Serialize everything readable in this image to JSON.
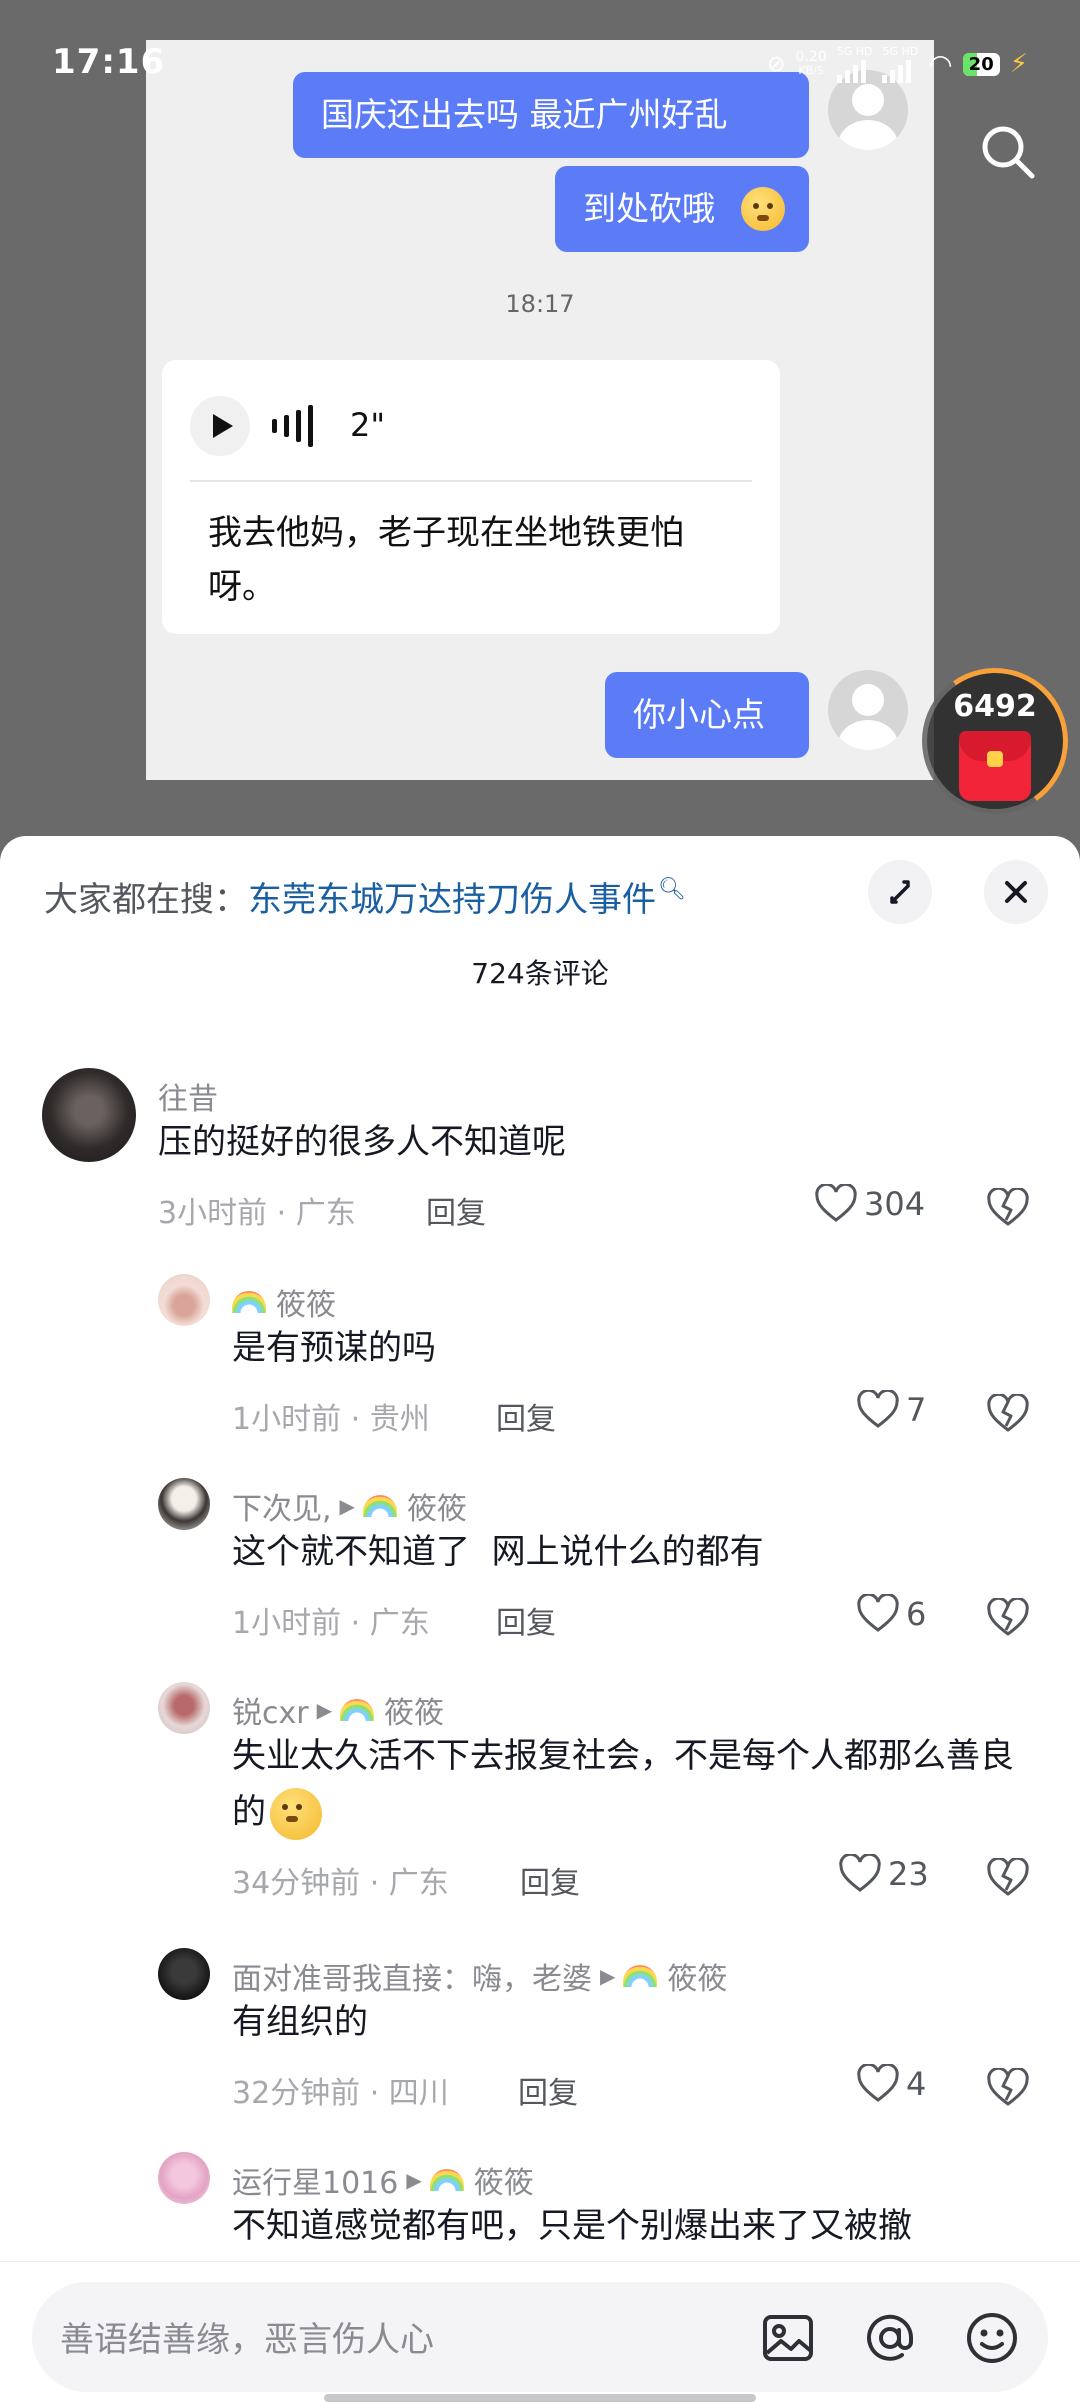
{
  "status_bar": {
    "time": "17:16",
    "net_speed": "0.20",
    "net_unit": "KB/S",
    "sim1": "5G HD",
    "sim2": "5G HD",
    "battery": "20"
  },
  "video": {
    "chat": {
      "msg1": "国庆还出去吗 最近广州好乱",
      "msg2": "到处砍哦",
      "timestamp": "18:17",
      "voice_duration": "2\"",
      "voice_transcript": "我去他妈，老子现在坐地铁更怕呀。",
      "msg3": "你小心点"
    },
    "red_packet_count": "6492"
  },
  "comment_panel": {
    "hot_prefix": "大家都在搜：",
    "hot_topic": "东莞东城万达持刀伤人事件",
    "count_label": "724条评论",
    "comments": [
      {
        "name": "往昔",
        "text": "压的挺好的很多人不知道呢",
        "meta": "3小时前 · 广东",
        "reply": "回复",
        "likes": "304"
      },
      {
        "name": "筱筱",
        "text": "是有预谋的吗",
        "meta": "1小时前 · 贵州",
        "reply": "回复",
        "likes": "7"
      },
      {
        "name": "下次见,",
        "target": "筱筱",
        "text": "这个就不知道了  网上说什么的都有",
        "meta": "1小时前 · 广东",
        "reply": "回复",
        "likes": "6"
      },
      {
        "name": "锐cxr",
        "target": "筱筱",
        "text": "失业太久活不下去报复社会，不是每个人都那么善良的",
        "meta": "34分钟前 · 广东",
        "reply": "回复",
        "likes": "23"
      },
      {
        "name": "面对准哥我直接：嗨，老婆",
        "target": "筱筱",
        "text": "有组织的",
        "meta": "32分钟前 · 四川",
        "reply": "回复",
        "likes": "4"
      },
      {
        "name": "运行星1016",
        "target": "筱筱",
        "text": "不知道感觉都有吧，只是个别爆出来了又被撤"
      }
    ]
  },
  "input": {
    "placeholder": "善语结善缘，恶言伤人心"
  },
  "colors": {
    "accent_blue": "#5b7cf6",
    "link_blue": "#1b5fa3",
    "red_packet": "#f2243a"
  }
}
